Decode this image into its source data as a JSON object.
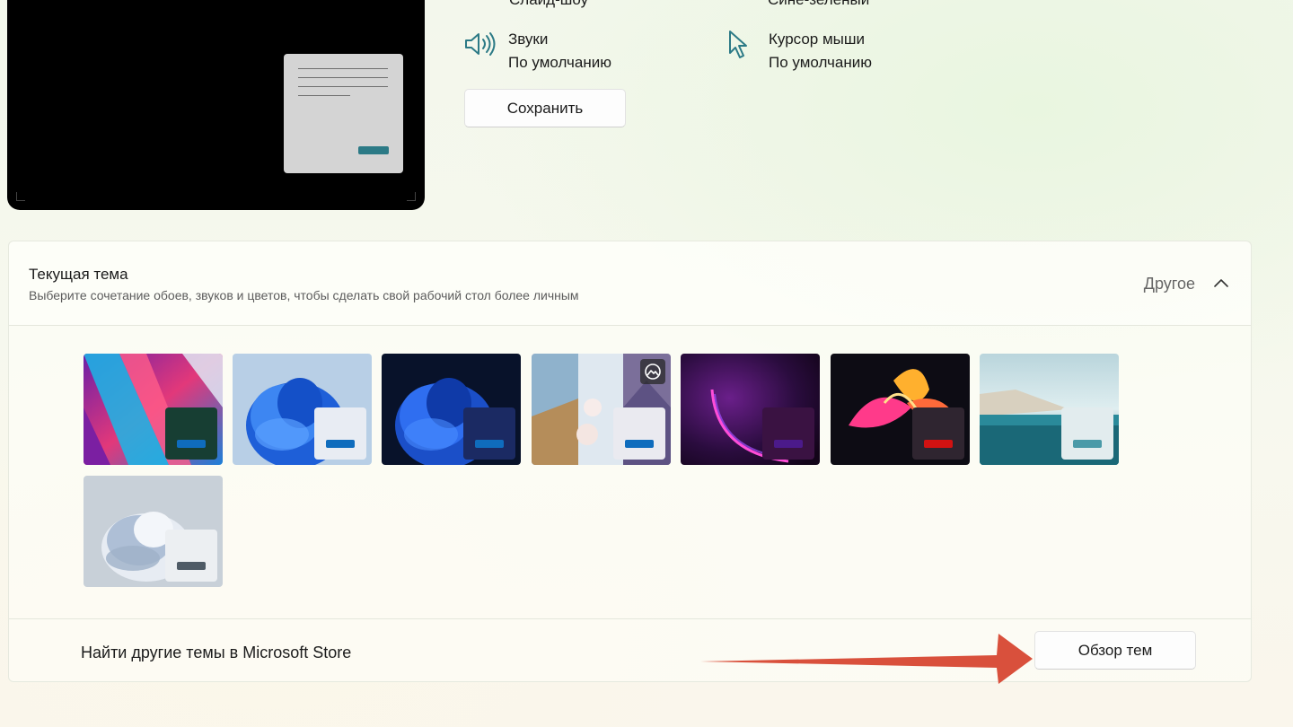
{
  "top": {
    "cut_left": "Слайд-шоу",
    "cut_right": "Сине-зеленый",
    "sounds": {
      "label": "Звуки",
      "value": "По умолчанию"
    },
    "cursor": {
      "label": "Курсор мыши",
      "value": "По умолчанию"
    },
    "save_label": "Сохранить"
  },
  "panel": {
    "title": "Текущая тема",
    "subtitle": "Выберите сочетание обоев, звуков и цветов, чтобы сделать свой рабочий стол более личным",
    "value": "Другое",
    "footer_text": "Найти другие темы в Microsoft Store",
    "browse_label": "Обзор тем"
  },
  "themes": [
    {
      "accent": "#0f6cbd",
      "mini_bg": "#173e33"
    },
    {
      "accent": "#0f6cbd",
      "mini_bg": "#e8ecf3"
    },
    {
      "accent": "#0f6cbd",
      "mini_bg": "#1b2a63"
    },
    {
      "accent": "#0f6cbd",
      "mini_bg": "#eaeaf0"
    },
    {
      "accent": "#4b1a8a",
      "mini_bg": "#3a1242"
    },
    {
      "accent": "#d11212",
      "mini_bg": "#2f2530"
    },
    {
      "accent": "#4a9aa8",
      "mini_bg": "#e2ecee"
    },
    {
      "accent": "#4f5b66",
      "mini_bg": "#eceff2"
    }
  ],
  "colors": {
    "preview_accent": "#2c7a86",
    "icon_teal": "#2c7a86",
    "arrow": "#d9503c"
  }
}
